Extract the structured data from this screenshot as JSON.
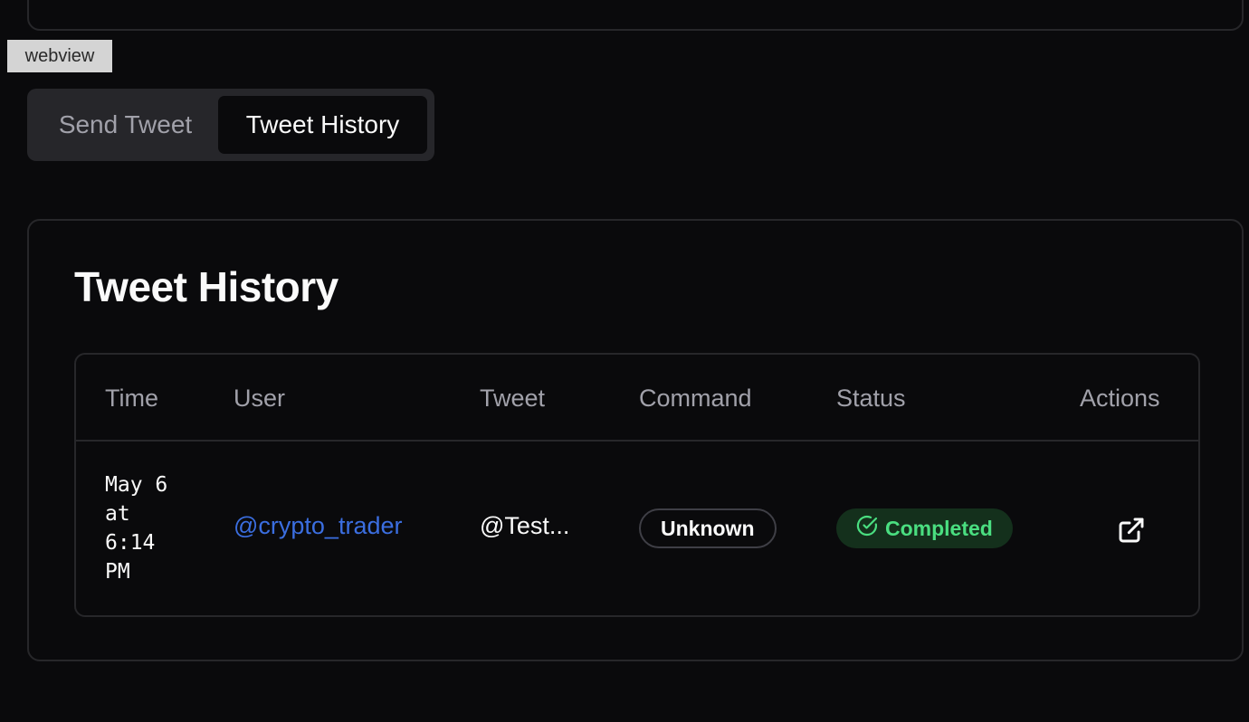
{
  "overlay": {
    "label": "webview"
  },
  "tabs": [
    {
      "label": "Send Tweet",
      "active": false
    },
    {
      "label": "Tweet History",
      "active": true
    }
  ],
  "history": {
    "title": "Tweet History",
    "columns": [
      "Time",
      "User",
      "Tweet",
      "Command",
      "Status",
      "Actions"
    ],
    "rows": [
      {
        "time_lines": [
          "May 6",
          "at",
          "6:14",
          "PM"
        ],
        "user": "@crypto_trader",
        "tweet": "@Test...",
        "command": "Unknown",
        "status": "Completed",
        "action_icon": "external-link-icon"
      }
    ]
  },
  "colors": {
    "background": "#0a0a0c",
    "border": "#27272a",
    "link": "#3b6ee0",
    "success_text": "#4ade80",
    "success_bg": "#14301c",
    "muted_text": "#a1a1aa"
  }
}
